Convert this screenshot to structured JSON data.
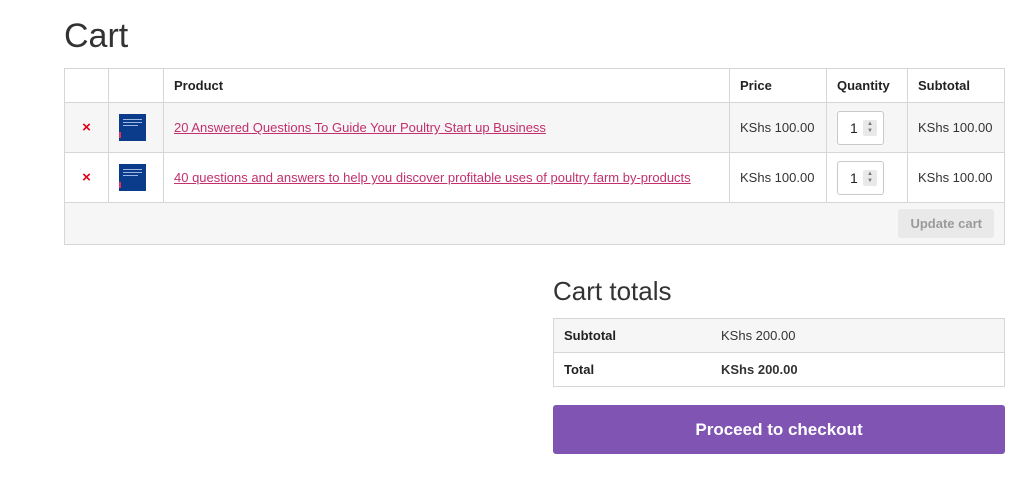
{
  "cart": {
    "title": "Cart",
    "columns": {
      "product": "Product",
      "price": "Price",
      "quantity": "Quantity",
      "subtotal": "Subtotal"
    },
    "items": [
      {
        "remove_icon": "×",
        "thumbnail_icon": "book-cover-thumbnail",
        "name": "20 Answered Questions To Guide Your Poultry Start up Business",
        "price": "KShs 100.00",
        "quantity": "1",
        "subtotal": "KShs 100.00"
      },
      {
        "remove_icon": "×",
        "thumbnail_icon": "book-cover-thumbnail",
        "name": "40 questions and answers to help you discover profitable uses of poultry farm by-products",
        "price": "KShs 100.00",
        "quantity": "1",
        "subtotal": "KShs 100.00"
      }
    ],
    "update_label": "Update cart"
  },
  "totals": {
    "title": "Cart totals",
    "subtotal_label": "Subtotal",
    "subtotal_value": "KShs 200.00",
    "total_label": "Total",
    "total_value": "KShs 200.00"
  },
  "checkout": {
    "label": "Proceed to checkout"
  },
  "colors": {
    "accent": "#7f54b3",
    "link": "#c2306d",
    "remove": "#e2001a",
    "thumbnail": "#0b3c8c"
  }
}
